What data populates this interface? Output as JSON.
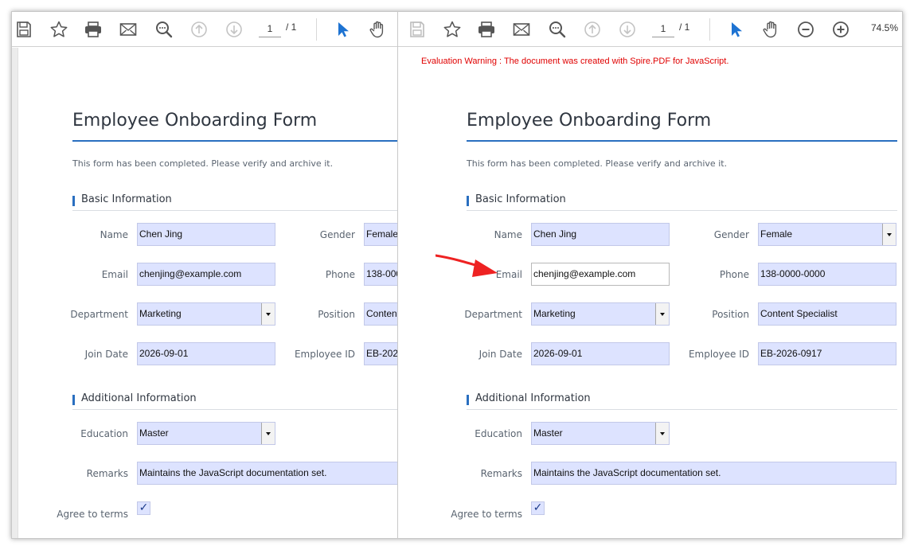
{
  "toolbar": {
    "page_current": "1",
    "page_total": "/ 1",
    "zoom": "74.5%"
  },
  "warning": "Evaluation Warning : The document was created with Spire.PDF for JavaScript.",
  "form": {
    "title": "Employee Onboarding Form",
    "note": "This form has been completed. Please verify and archive it.",
    "section_basic": "Basic Information",
    "section_additional": "Additional Information",
    "labels": {
      "name": "Name",
      "gender": "Gender",
      "email": "Email",
      "phone": "Phone",
      "department": "Department",
      "position": "Position",
      "join_date": "Join Date",
      "employee_id": "Employee ID",
      "education": "Education",
      "remarks": "Remarks",
      "agree": "Agree to terms"
    },
    "values": {
      "name": "Chen Jing",
      "gender": "Female",
      "email": "chenjing@example.com",
      "phone": "138-0000-0000",
      "department": "Marketing",
      "position": "Content Specialist",
      "join_date": "2026-09-01",
      "employee_id": "EB-2026-0917",
      "education": "Master",
      "remarks": "Maintains the JavaScript documentation set.",
      "agree_mark": "✓"
    }
  },
  "colors": {
    "accent": "#2a6fc0",
    "field_bg": "#dde3ff",
    "warning": "#e00000",
    "annotation_arrow": "#ee2222"
  },
  "icons": [
    "save-icon",
    "star-icon",
    "print-icon",
    "mail-icon",
    "search-icon",
    "arrow-up-icon",
    "arrow-down-icon",
    "cursor-icon",
    "hand-icon",
    "zoom-out-icon",
    "zoom-in-icon"
  ]
}
